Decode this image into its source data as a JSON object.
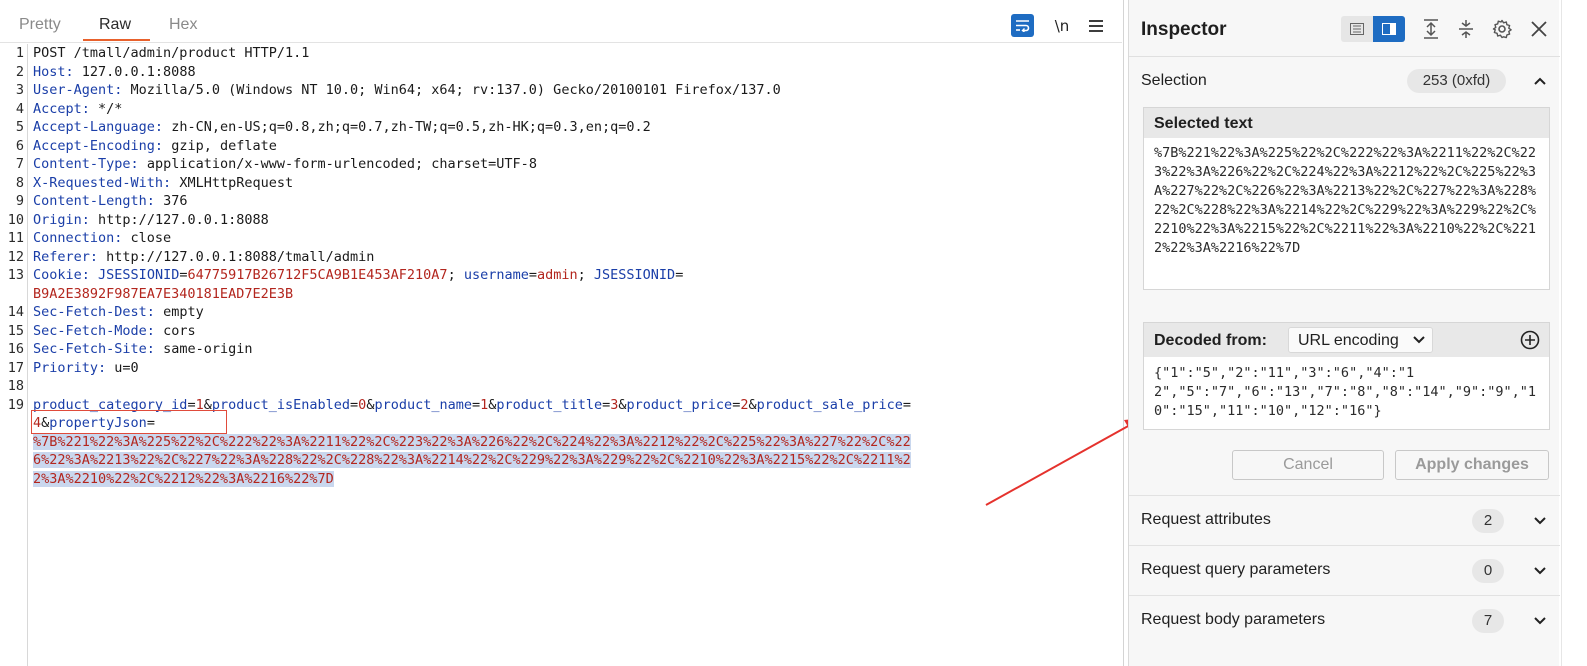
{
  "tabs": {
    "pretty": "Pretty",
    "raw": "Raw",
    "hex": "Hex"
  },
  "toolbar": {
    "newline_label": "\\n"
  },
  "request": {
    "line_numbers": [
      "1",
      "2",
      "3",
      "4",
      "5",
      "6",
      "7",
      "8",
      "9",
      "10",
      "11",
      "12",
      "13",
      "14",
      "15",
      "16",
      "17",
      "18",
      "19"
    ],
    "request_line": "POST /tmall/admin/product HTTP/1.1",
    "headers": [
      {
        "name": "Host",
        "value": "127.0.0.1:8088"
      },
      {
        "name": "User-Agent",
        "value": "Mozilla/5.0 (Windows NT 10.0; Win64; x64; rv:137.0) Gecko/20100101 Firefox/137.0"
      },
      {
        "name": "Accept",
        "value": "*/*"
      },
      {
        "name": "Accept-Language",
        "value": "zh-CN,en-US;q=0.8,zh;q=0.7,zh-TW;q=0.5,zh-HK;q=0.3,en;q=0.2"
      },
      {
        "name": "Accept-Encoding",
        "value": "gzip, deflate"
      },
      {
        "name": "Content-Type",
        "value": "application/x-www-form-urlencoded; charset=UTF-8"
      },
      {
        "name": "X-Requested-With",
        "value": "XMLHttpRequest"
      },
      {
        "name": "Content-Length",
        "value": "376"
      },
      {
        "name": "Origin",
        "value": "http://127.0.0.1:8088"
      },
      {
        "name": "Connection",
        "value": "close"
      },
      {
        "name": "Referer",
        "value": "http://127.0.0.1:8088/tmall/admin"
      }
    ],
    "cookie": {
      "name": "Cookie",
      "c1_name": "JSESSIONID",
      "c1_value": "64775917B26712F5CA9B1E453AF210A7",
      "c2_name": "username",
      "c2_value": "admin",
      "c3_name": "JSESSIONID",
      "c3_value": "B9A2E3892F987EA7E340181EAD7E2E3B"
    },
    "headers_after": [
      {
        "name": "Sec-Fetch-Dest",
        "value": "empty"
      },
      {
        "name": "Sec-Fetch-Mode",
        "value": "cors"
      },
      {
        "name": "Sec-Fetch-Site",
        "value": "same-origin"
      },
      {
        "name": "Priority",
        "value": "u=0"
      }
    ],
    "body": {
      "params": [
        {
          "name": "product_category_id",
          "value": "1"
        },
        {
          "name": "product_isEnabled",
          "value": "0"
        },
        {
          "name": "product_name",
          "value": "1"
        },
        {
          "name": "product_title",
          "value": "3"
        },
        {
          "name": "product_price",
          "value": "2"
        },
        {
          "name": "product_sale_price",
          "value": "4"
        },
        {
          "name": "propertyJson",
          "value": ""
        }
      ],
      "property_json_encoded_lines": [
        "%7B%221%22%3A%225%22%2C%222%22%3A%2211%22%2C%223%22%3A%226%22%2C%224%22%3A%2212%22%2C%225%22%3A%227%22%2C%22",
        "6%22%3A%2213%22%2C%227%22%3A%228%22%2C%228%22%3A%2214%22%2C%229%22%3A%229%22%2C%2210%22%3A%2215%22%2C%2211%2",
        "2%3A%2210%22%2C%2212%22%3A%2216%22%7D"
      ]
    }
  },
  "inspector": {
    "title": "Inspector",
    "selection_label": "Selection",
    "selection_count": "253 (0xfd)",
    "selected_text_title": "Selected text",
    "selected_text": "%7B%221%22%3A%225%22%2C%222%22%3A%2211%22%2C%223%22%3A%226%22%2C%224%22%3A%2212%22%2C%225%22%3A%227%22%2C%226%22%3A%2213%22%2C%227%22%3A%228%22%2C%228%22%3A%2214%22%2C%229%22%3A%229%22%2C%2210%22%3A%2215%22%2C%2211%22%3A%2210%22%2C%2212%22%3A%2216%22%7D",
    "decoded_from_label": "Decoded from:",
    "decoding": "URL encoding",
    "decoded_text": "{\"1\":\"5\",\"2\":\"11\",\"3\":\"6\",\"4\":\"12\",\"5\":\"7\",\"6\":\"13\",\"7\":\"8\",\"8\":\"14\",\"9\":\"9\",\"10\":\"15\",\"11\":\"10\",\"12\":\"16\"}",
    "cancel_label": "Cancel",
    "apply_label": "Apply changes",
    "sections": [
      {
        "label": "Request attributes",
        "count": "2"
      },
      {
        "label": "Request query parameters",
        "count": "0"
      },
      {
        "label": "Request body parameters",
        "count": "7"
      }
    ]
  },
  "colors": {
    "accent": "#1e6cc2",
    "tab_underline": "#e8612c",
    "header_name": "#1a3ea8",
    "value_red": "#b3261e",
    "selection": "#c9d7ee",
    "annotation": "#e5322d"
  }
}
